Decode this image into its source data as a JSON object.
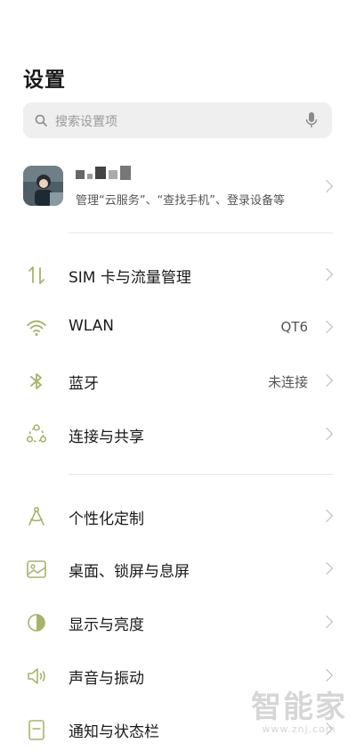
{
  "header": {
    "title": "设置"
  },
  "search": {
    "placeholder": "搜索设置项"
  },
  "account": {
    "description": "管理“云服务”、“查找手机”、登录设备等"
  },
  "sections": [
    {
      "items": [
        {
          "label": "SIM 卡与流量管理",
          "value": "",
          "icon": "sim-data-icon"
        },
        {
          "label": "WLAN",
          "value": "QT6",
          "icon": "wifi-icon"
        },
        {
          "label": "蓝牙",
          "value": "未连接",
          "icon": "bluetooth-icon"
        },
        {
          "label": "连接与共享",
          "value": "",
          "icon": "share-icon"
        }
      ]
    },
    {
      "items": [
        {
          "label": "个性化定制",
          "value": "",
          "icon": "compass-icon"
        },
        {
          "label": "桌面、锁屏与息屏",
          "value": "",
          "icon": "wallpaper-icon"
        },
        {
          "label": "显示与亮度",
          "value": "",
          "icon": "brightness-icon"
        },
        {
          "label": "声音与振动",
          "value": "",
          "icon": "speaker-icon"
        },
        {
          "label": "通知与状态栏",
          "value": "",
          "icon": "notification-icon"
        }
      ]
    }
  ],
  "watermark": {
    "main": "智能家",
    "sub": "www.znj.com"
  },
  "colors": {
    "accent": "#a7b36a",
    "background": "#ffffff",
    "search_bg": "#efefef"
  }
}
